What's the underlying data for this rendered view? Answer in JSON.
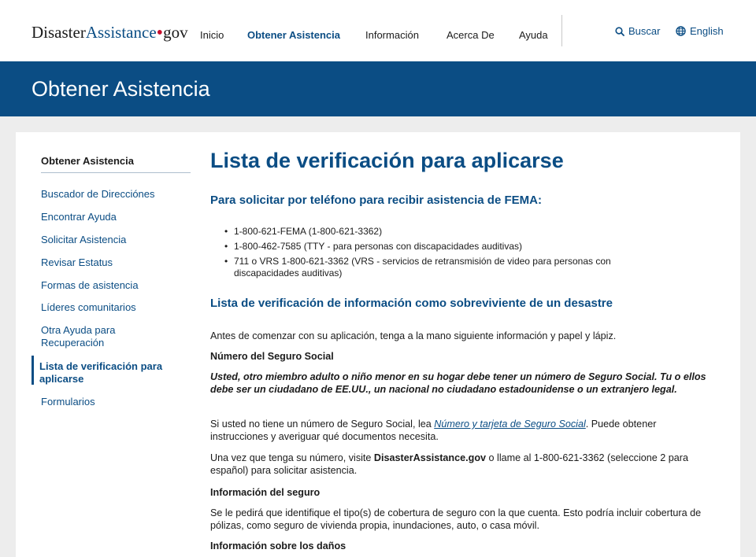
{
  "header": {
    "logo": {
      "part1": "Disaster",
      "part2": "Assistance",
      "dot": "•",
      "part3": "gov"
    },
    "nav": [
      {
        "label": "Inicio"
      },
      {
        "label": "Obtener Asistencia",
        "active": true
      },
      {
        "label": "Información"
      },
      {
        "label": "Acerca De"
      },
      {
        "label": "Ayuda"
      }
    ],
    "search_label": "Buscar",
    "language_label": "English"
  },
  "banner": {
    "title": "Obtener Asistencia"
  },
  "sidebar": {
    "title": "Obtener Asistencia",
    "items": [
      {
        "label": "Buscador de Direcciónes"
      },
      {
        "label": "Encontrar Ayuda"
      },
      {
        "label": "Solicitar Asistencia"
      },
      {
        "label": "Revisar Estatus"
      },
      {
        "label": "Formas de asistencia"
      },
      {
        "label": "Líderes comunitarios"
      },
      {
        "label": "Otra Ayuda para Recuperación"
      },
      {
        "label": "Lista de verificación para aplicarse",
        "active": true
      },
      {
        "label": "Formularios"
      }
    ]
  },
  "main": {
    "title": "Lista de verificación para aplicarse",
    "phone_heading": "Para solicitar por teléfono para recibir asistencia de FEMA:",
    "phone_list": [
      "1-800-621-FEMA (1-800-621-3362)",
      "1-800-462-7585 (TTY - para personas con discapacidades auditivas)",
      "711 o VRS 1-800-621-3362 (VRS - servicios de retransmisión de video para personas con discapacidades auditivas)"
    ],
    "checklist_heading": "Lista de verificación de información como sobreviviente de un desastre",
    "intro": "Antes de comenzar con su aplicación, tenga a la mano siguiente información y papel y lápiz.",
    "ssn_heading": "Número del Seguro Social",
    "ssn_emphasis": "Usted, otro miembro adulto o niño menor en su hogar debe tener un número de Seguro Social. Tu o ellos debe ser un ciudadano de EE.UU., un nacional no ciudadano estadounidense o un extranjero legal.",
    "ssn_p1_before": "Si usted no tiene un número de Seguro Social, lea ",
    "ssn_p1_link": "Número y tarjeta de Seguro Social",
    "ssn_p1_after": ". Puede obtener instrucciones y averiguar qué documentos necesita.",
    "ssn_p2_before": "Una vez que tenga su número, visite ",
    "ssn_p2_bold": "DisasterAssistance.gov",
    "ssn_p2_after": " o llame al 1-800-621-3362 (seleccione 2 para español) para solicitar asistencia.",
    "insurance_heading": "Información del seguro",
    "insurance_p": "Se le pedirá que identifique el tipo(s) de cobertura de seguro con la que cuenta. Esto podría incluir cobertura de pólizas, como seguro de vivienda propia, inundaciones, auto, o casa móvil.",
    "next_heading_partial": "Información sobre los daños"
  },
  "colors": {
    "brand_navy": "#0b4d84",
    "logo_dot": "#c8102e",
    "page_bg": "#ededed"
  },
  "icons": {
    "search": "search-icon",
    "language": "globe-icon"
  }
}
